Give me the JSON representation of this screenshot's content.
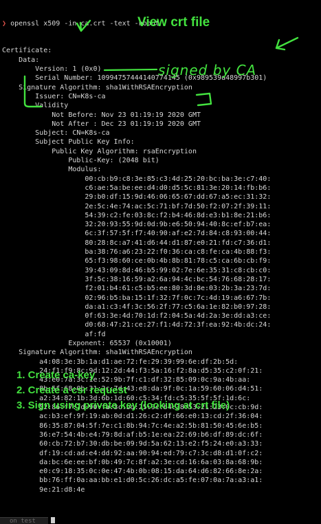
{
  "terminal": {
    "prompt_symbol": "❯",
    "command": "openssl x509 -in ca.crt -text -noout",
    "lines": [
      "Certificate:",
      "    Data:",
      "        Version: 1 (0x0)",
      "        Serial Number: 10994757444140774145 (0x989539a48997b301)",
      "    Signature Algorithm: sha1WithRSAEncryption",
      "        Issuer: CN=K8s-ca",
      "        Validity",
      "            Not Before: Nov 23 01:19:19 2020 GMT",
      "            Not After : Dec 23 01:19:19 2020 GMT",
      "        Subject: CN=K8s-ca",
      "        Subject Public Key Info:",
      "            Public Key Algorithm: rsaEncryption",
      "                Public-Key: (2048 bit)",
      "                Modulus:",
      "                    00:cb:b9:c8:3e:85:c3:4d:25:20:bc:ba:3e:c7:40:",
      "                    c6:ae:5a:be:ee:d4:d0:d5:5c:81:3e:20:14:fb:b6:",
      "                    29:b0:df:15:9d:46:06:65:67:dd:67:a5:ec:31:32:",
      "                    2e:5c:4e:74:ac:5c:71:bf:7d:50:f2:07:2f:39:11:",
      "                    54:39:c2:fe:03:8c:f2:b4:46:8d:e3:b1:8e:21:b6:",
      "                    32:20:93:55:9d:0d:9b:e6:50:94:40:8c:ef:b7:ea:",
      "                    6c:3f:57:5f:f7:40:90:af:e2:7d:84:c8:93:00:44:",
      "                    80:28:8c:a7:41:d6:44:d1:87:e0:21:fd:c7:36:d1:",
      "                    ba:38:76:a6:23:22:f0:36:ca:c8:fe:ca:4b:88:f3:",
      "                    65:f3:98:60:ce:0b:4b:8b:81:78:c5:ca:6b:cb:f9:",
      "                    39:43:09:8d:46:b5:99:02:7e:6e:35:31:c8:cb:c0:",
      "                    3f:5c:38:16:59:a2:6a:94:4c:bc:54:76:68:28:17:",
      "                    f2:01:b4:61:c5:b5:ee:80:3d:8e:03:2b:3a:23:7d:",
      "                    02:96:b5:ba:15:1f:32:7f:0c:7c:4d:19:a6:67:7b:",
      "                    da:a1:c3:4f:3c:56:2f:77:c5:6a:1e:82:b0:97:28:",
      "                    0f:63:3e:4d:70:1d:f2:04:5a:4d:2a:3e:dd:a3:ce:",
      "                    d0:68:47:21:ce:27:f1:4d:72:3f:ea:92:4b:dc:24:",
      "                    af:fd",
      "                Exponent: 65537 (0x10001)",
      "    Signature Algorithm: sha1WithRSAEncryption",
      "         a4:08:3e:3b:1a:d1:ae:72:fe:29:39:99:6e:df:2b:5d:",
      "         24:f1:f9:8c:9d:12:2d:44:f3:5a:16:f2:8a:d5:35:c2:0f:21:",
      "         43:e0:7a:3c:1e:52:9b:7f:c1:df:32:85:09:0c:9a:4b:aa:",
      "         8b:5f:68:0b:31:2c:7d:43:e8:da:9f:0c:1a:59:60:06:d4:51:",
      "         a2:34:82:1b:3d:6b:1d:60:c5:34:fd:c5:35:5f:5f:1d:6c:",
      "         52:86:f7:7d:90:fa:3c:bd:25:9c:b4:38:53:21:23:0c:cb:9d:",
      "         ac:b3:ef:9f:19:ab:0d:d1:26:c2:df:66:e0:13:cd:2f:36:04:",
      "         86:35:87:04:5f:7e:c1:8b:94:7c:4e:a2:5b:81:50:45:6e:b5:",
      "         36:e7:54:4b:e4:79:8d:af:b5:1e:ea:22:69:b6:df:89:dc:6f:",
      "         60:cb:72:b7:30:db:be:09:9d:5a:62:13:e2:f5:24:e0:a3:33:",
      "         df:19:cd:ad:e4:dd:92:aa:90:94:ed:79:c7:3c:d8:d1:0f:c2:",
      "         da:bc:6e:ee:bf:0b:49:7c:8f:a2:3e:cd:16:6a:03:8a:68:9b:",
      "         e0:c9:18:35:0c:0e:47:4b:0b:08:15:da:64:d6:82:66:8e:2a:",
      "         bb:76:ff:0a:aa:bb:e1:d0:5c:26:dc:a5:fe:07:0a:7a:a3:a1:",
      "         9e:21:d8:4e"
    ],
    "bottom_tab_label": "on test"
  },
  "annotations": {
    "title": "View crt file",
    "signed": "signed by CA",
    "steps": [
      "1. Create ca-key",
      "2. Create a csr request",
      "3. Sign using private key (looking at crt file)"
    ],
    "color": "#43e23f"
  }
}
